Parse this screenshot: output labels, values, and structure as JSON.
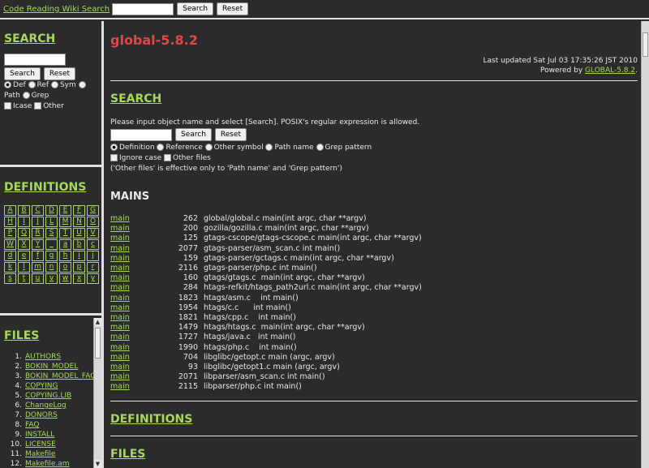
{
  "top": {
    "title": "Code Reading Wiki Search",
    "search_btn": "Search",
    "reset_btn": "Reset",
    "input_value": ""
  },
  "left_search": {
    "title": "SEARCH",
    "search_btn": "Search",
    "reset_btn": "Reset",
    "opts": {
      "def": "Def",
      "ref": "Ref",
      "sym": "Sym",
      "path": "Path",
      "grep": "Grep",
      "icase": "Icase",
      "other": "Other"
    }
  },
  "left_defs": {
    "title": "DEFINITIONS",
    "letters": [
      "A",
      "B",
      "C",
      "D",
      "E",
      "F",
      "G",
      "H",
      "I",
      "J",
      "L",
      "M",
      "N",
      "O",
      "P",
      "Q",
      "R",
      "S",
      "T",
      "U",
      "V",
      "W",
      "X",
      "Y",
      "_",
      "a",
      "b",
      "c",
      "d",
      "e",
      "f",
      "g",
      "h",
      "i",
      "j",
      "k",
      "l",
      "m",
      "n",
      "o",
      "p",
      "r",
      "s",
      "t",
      "u",
      "v",
      "w",
      "x",
      "y"
    ]
  },
  "left_files": {
    "title": "FILES",
    "items": [
      {
        "n": "1.",
        "name": "AUTHORS"
      },
      {
        "n": "2.",
        "name": "BOKIN_MODEL"
      },
      {
        "n": "3.",
        "name": "BOKIN_MODEL_FAQ"
      },
      {
        "n": "4.",
        "name": "COPYING"
      },
      {
        "n": "5.",
        "name": "COPYING.LIB"
      },
      {
        "n": "6.",
        "name": "ChangeLog"
      },
      {
        "n": "7.",
        "name": "DONORS"
      },
      {
        "n": "8.",
        "name": "FAQ"
      },
      {
        "n": "9.",
        "name": "INSTALL"
      },
      {
        "n": "10.",
        "name": "LICENSE"
      },
      {
        "n": "11.",
        "name": "Makefile"
      },
      {
        "n": "12.",
        "name": "Makefile.am"
      }
    ]
  },
  "main": {
    "title": "global-5.8.2",
    "updated": "Last updated Sat Jul 03 17:35:26 JST 2010",
    "powered_prefix": "Powered by ",
    "powered_link": "GLOBAL-5.8.2",
    "powered_suffix": ".",
    "search_title": "SEARCH",
    "hint": "Please input object name and select [Search]. POSIX's regular expression is allowed.",
    "search_btn": "Search",
    "reset_btn": "Reset",
    "opts": {
      "definition": "Definition",
      "reference": "Reference",
      "other_symbol": "Other symbol",
      "path_name": "Path name",
      "grep_pattern": "Grep pattern",
      "ignore_case": "Ignore case",
      "other_files": "Other files"
    },
    "note": "('Other files' is effective only to 'Path name' and 'Grep pattern')",
    "mains_title": "MAINS",
    "mains": [
      {
        "link": "main",
        "line": "262",
        "text": "global/global.c main(int argc, char **argv)"
      },
      {
        "link": "main",
        "line": "200",
        "text": "gozilla/gozilla.c main(int argc, char **argv)"
      },
      {
        "link": "main",
        "line": "125",
        "text": "gtags-cscope/gtags-cscope.c main(int argc, char **argv)"
      },
      {
        "link": "main",
        "line": "2077",
        "text": "gtags-parser/asm_scan.c int main()"
      },
      {
        "link": "main",
        "line": "159",
        "text": "gtags-parser/gctags.c main(int argc, char **argv)"
      },
      {
        "link": "main",
        "line": "2116",
        "text": "gtags-parser/php.c int main()"
      },
      {
        "link": "main",
        "line": "160",
        "text": "gtags/gtags.c  main(int argc, char **argv)"
      },
      {
        "link": "main",
        "line": "284",
        "text": "htags-refkit/htags_path2url.c main(int argc, char **argv)"
      },
      {
        "link": "main",
        "line": "1823",
        "text": "htags/asm.c    int main()"
      },
      {
        "link": "main",
        "line": "1954",
        "text": "htags/c.c      int main()"
      },
      {
        "link": "main",
        "line": "1821",
        "text": "htags/cpp.c    int main()"
      },
      {
        "link": "main",
        "line": "1479",
        "text": "htags/htags.c  main(int argc, char **argv)"
      },
      {
        "link": "main",
        "line": "1727",
        "text": "htags/java.c   int main()"
      },
      {
        "link": "main",
        "line": "1990",
        "text": "htags/php.c    int main()"
      },
      {
        "link": "main",
        "line": "704",
        "text": "libglibc/getopt.c main (argc, argv)"
      },
      {
        "link": "main",
        "line": "93",
        "text": "libglibc/getopt1.c main (argc, argv)"
      },
      {
        "link": "main",
        "line": "2071",
        "text": "libparser/asm_scan.c int main()"
      },
      {
        "link": "main",
        "line": "2115",
        "text": "libparser/php.c int main()"
      }
    ],
    "defs_title": "DEFINITIONS",
    "files_title": "FILES"
  }
}
